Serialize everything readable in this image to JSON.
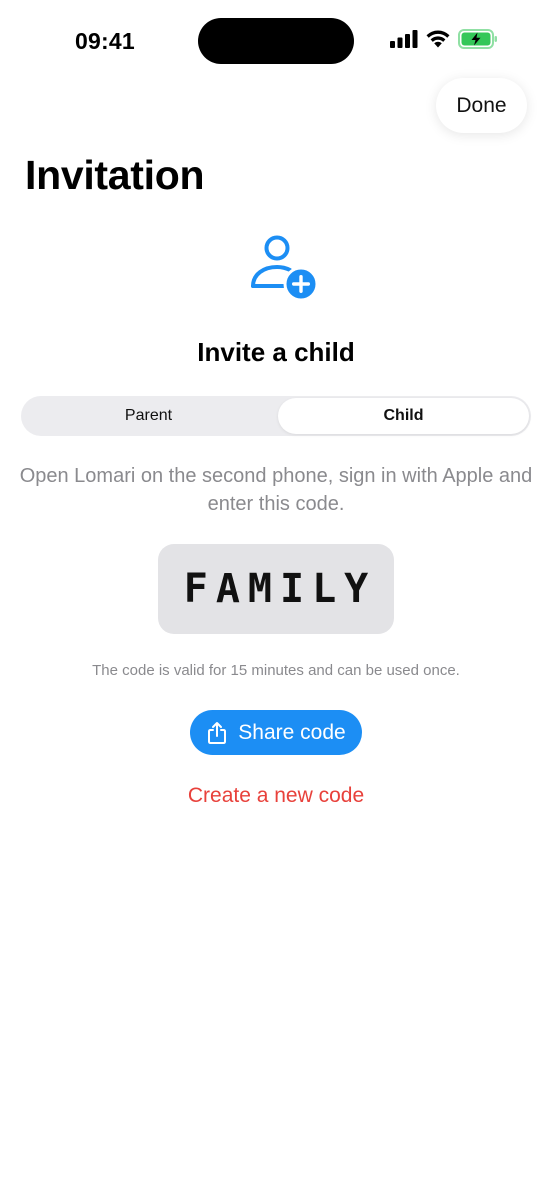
{
  "status_bar": {
    "time": "09:41"
  },
  "header": {
    "done_label": "Done",
    "title": "Invitation"
  },
  "hero": {
    "icon": "person-add-icon",
    "heading": "Invite a child"
  },
  "segmented_control": {
    "options": [
      "Parent",
      "Child"
    ],
    "selected": "Child"
  },
  "instructions": "Open Lomari on the second phone, sign in with Apple and enter this code.",
  "code": "FAMILY",
  "validity_note": "The code is valid for 15 minutes and can be used once.",
  "share_button": {
    "label": "Share code",
    "icon": "share-icon"
  },
  "new_code_label": "Create a new code",
  "colors": {
    "accent": "#1c8ef4",
    "destructive": "#e8413b",
    "battery": "#34c759",
    "secondary_text": "#8a8a8e"
  }
}
